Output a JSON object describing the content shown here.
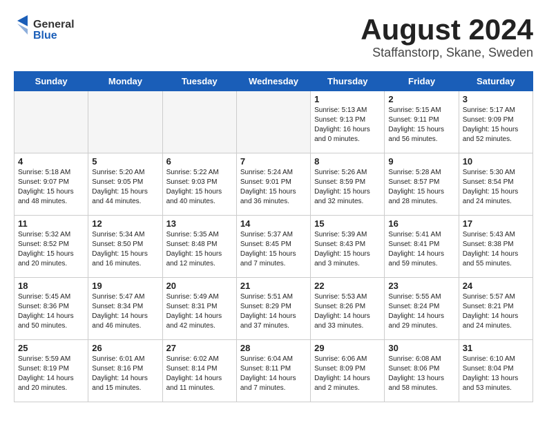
{
  "header": {
    "logo_general": "General",
    "logo_blue": "Blue",
    "month_title": "August 2024",
    "location": "Staffanstorp, Skane, Sweden"
  },
  "days_of_week": [
    "Sunday",
    "Monday",
    "Tuesday",
    "Wednesday",
    "Thursday",
    "Friday",
    "Saturday"
  ],
  "weeks": [
    [
      {
        "day": "",
        "info": ""
      },
      {
        "day": "",
        "info": ""
      },
      {
        "day": "",
        "info": ""
      },
      {
        "day": "",
        "info": ""
      },
      {
        "day": "1",
        "info": "Sunrise: 5:13 AM\nSunset: 9:13 PM\nDaylight: 16 hours\nand 0 minutes."
      },
      {
        "day": "2",
        "info": "Sunrise: 5:15 AM\nSunset: 9:11 PM\nDaylight: 15 hours\nand 56 minutes."
      },
      {
        "day": "3",
        "info": "Sunrise: 5:17 AM\nSunset: 9:09 PM\nDaylight: 15 hours\nand 52 minutes."
      }
    ],
    [
      {
        "day": "4",
        "info": "Sunrise: 5:18 AM\nSunset: 9:07 PM\nDaylight: 15 hours\nand 48 minutes."
      },
      {
        "day": "5",
        "info": "Sunrise: 5:20 AM\nSunset: 9:05 PM\nDaylight: 15 hours\nand 44 minutes."
      },
      {
        "day": "6",
        "info": "Sunrise: 5:22 AM\nSunset: 9:03 PM\nDaylight: 15 hours\nand 40 minutes."
      },
      {
        "day": "7",
        "info": "Sunrise: 5:24 AM\nSunset: 9:01 PM\nDaylight: 15 hours\nand 36 minutes."
      },
      {
        "day": "8",
        "info": "Sunrise: 5:26 AM\nSunset: 8:59 PM\nDaylight: 15 hours\nand 32 minutes."
      },
      {
        "day": "9",
        "info": "Sunrise: 5:28 AM\nSunset: 8:57 PM\nDaylight: 15 hours\nand 28 minutes."
      },
      {
        "day": "10",
        "info": "Sunrise: 5:30 AM\nSunset: 8:54 PM\nDaylight: 15 hours\nand 24 minutes."
      }
    ],
    [
      {
        "day": "11",
        "info": "Sunrise: 5:32 AM\nSunset: 8:52 PM\nDaylight: 15 hours\nand 20 minutes."
      },
      {
        "day": "12",
        "info": "Sunrise: 5:34 AM\nSunset: 8:50 PM\nDaylight: 15 hours\nand 16 minutes."
      },
      {
        "day": "13",
        "info": "Sunrise: 5:35 AM\nSunset: 8:48 PM\nDaylight: 15 hours\nand 12 minutes."
      },
      {
        "day": "14",
        "info": "Sunrise: 5:37 AM\nSunset: 8:45 PM\nDaylight: 15 hours\nand 7 minutes."
      },
      {
        "day": "15",
        "info": "Sunrise: 5:39 AM\nSunset: 8:43 PM\nDaylight: 15 hours\nand 3 minutes."
      },
      {
        "day": "16",
        "info": "Sunrise: 5:41 AM\nSunset: 8:41 PM\nDaylight: 14 hours\nand 59 minutes."
      },
      {
        "day": "17",
        "info": "Sunrise: 5:43 AM\nSunset: 8:38 PM\nDaylight: 14 hours\nand 55 minutes."
      }
    ],
    [
      {
        "day": "18",
        "info": "Sunrise: 5:45 AM\nSunset: 8:36 PM\nDaylight: 14 hours\nand 50 minutes."
      },
      {
        "day": "19",
        "info": "Sunrise: 5:47 AM\nSunset: 8:34 PM\nDaylight: 14 hours\nand 46 minutes."
      },
      {
        "day": "20",
        "info": "Sunrise: 5:49 AM\nSunset: 8:31 PM\nDaylight: 14 hours\nand 42 minutes."
      },
      {
        "day": "21",
        "info": "Sunrise: 5:51 AM\nSunset: 8:29 PM\nDaylight: 14 hours\nand 37 minutes."
      },
      {
        "day": "22",
        "info": "Sunrise: 5:53 AM\nSunset: 8:26 PM\nDaylight: 14 hours\nand 33 minutes."
      },
      {
        "day": "23",
        "info": "Sunrise: 5:55 AM\nSunset: 8:24 PM\nDaylight: 14 hours\nand 29 minutes."
      },
      {
        "day": "24",
        "info": "Sunrise: 5:57 AM\nSunset: 8:21 PM\nDaylight: 14 hours\nand 24 minutes."
      }
    ],
    [
      {
        "day": "25",
        "info": "Sunrise: 5:59 AM\nSunset: 8:19 PM\nDaylight: 14 hours\nand 20 minutes."
      },
      {
        "day": "26",
        "info": "Sunrise: 6:01 AM\nSunset: 8:16 PM\nDaylight: 14 hours\nand 15 minutes."
      },
      {
        "day": "27",
        "info": "Sunrise: 6:02 AM\nSunset: 8:14 PM\nDaylight: 14 hours\nand 11 minutes."
      },
      {
        "day": "28",
        "info": "Sunrise: 6:04 AM\nSunset: 8:11 PM\nDaylight: 14 hours\nand 7 minutes."
      },
      {
        "day": "29",
        "info": "Sunrise: 6:06 AM\nSunset: 8:09 PM\nDaylight: 14 hours\nand 2 minutes."
      },
      {
        "day": "30",
        "info": "Sunrise: 6:08 AM\nSunset: 8:06 PM\nDaylight: 13 hours\nand 58 minutes."
      },
      {
        "day": "31",
        "info": "Sunrise: 6:10 AM\nSunset: 8:04 PM\nDaylight: 13 hours\nand 53 minutes."
      }
    ]
  ]
}
